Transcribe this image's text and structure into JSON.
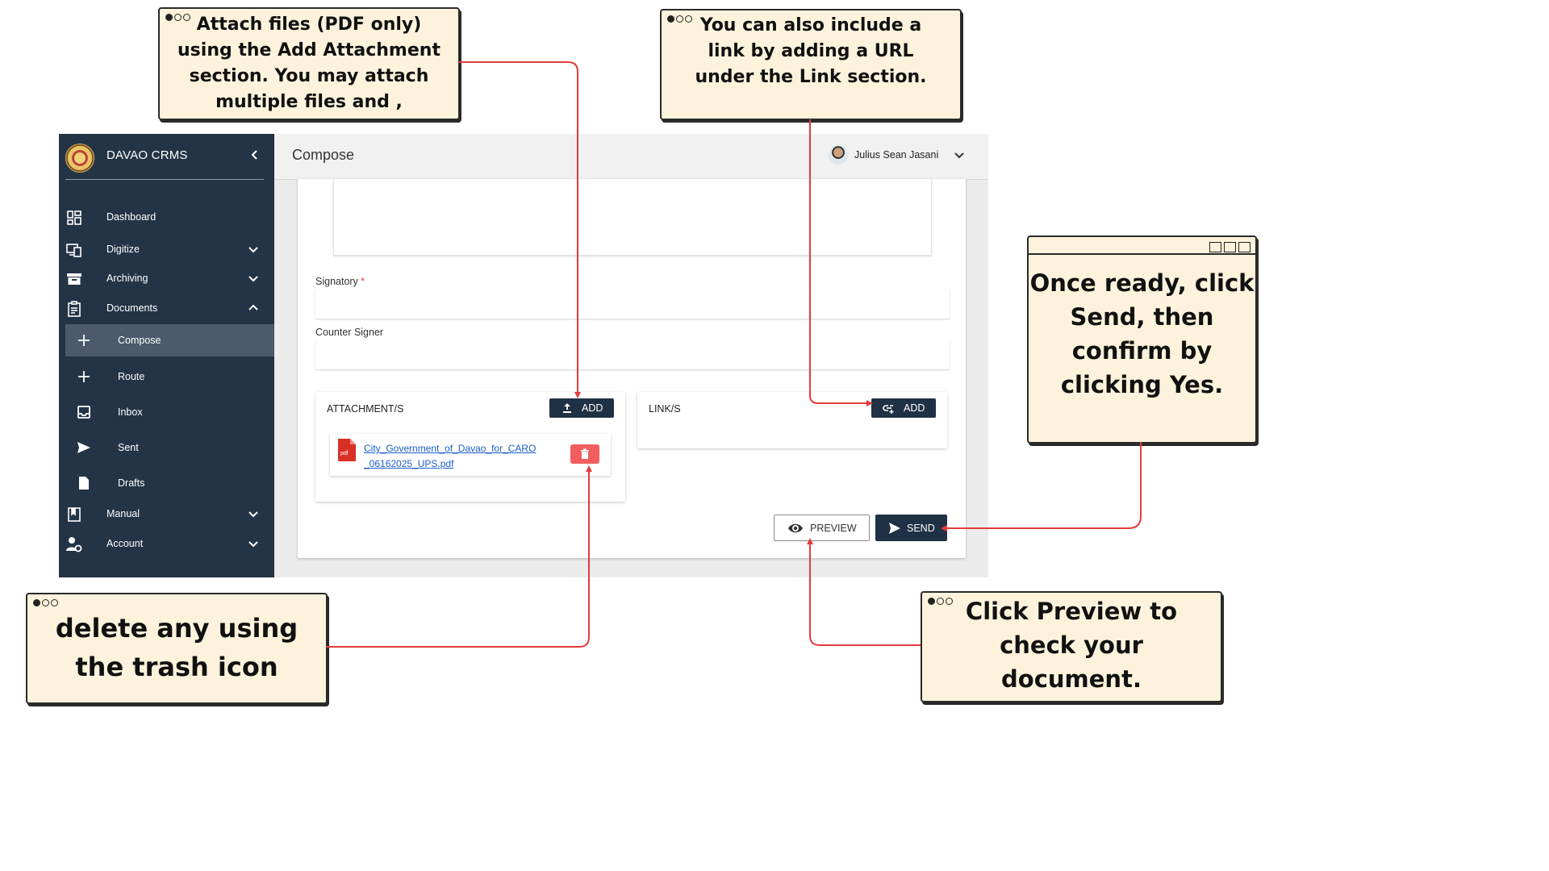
{
  "app": {
    "brand": "DAVAO CRMS",
    "page_title": "Compose",
    "user_name": "Julius Sean Jasani"
  },
  "sidebar": {
    "items": [
      {
        "label": "Dashboard",
        "icon": "dashboard-icon"
      },
      {
        "label": "Digitize",
        "icon": "digitize-icon"
      },
      {
        "label": "Archiving",
        "icon": "archive-icon"
      },
      {
        "label": "Documents",
        "icon": "documents-icon"
      },
      {
        "label": "Manual",
        "icon": "manual-icon"
      },
      {
        "label": "Account",
        "icon": "account-settings-icon"
      }
    ],
    "documents_sub": [
      {
        "label": "Compose",
        "icon": "plus-icon",
        "active": true
      },
      {
        "label": "Route",
        "icon": "plus-icon"
      },
      {
        "label": "Inbox",
        "icon": "inbox-icon"
      },
      {
        "label": "Sent",
        "icon": "send-icon"
      },
      {
        "label": "Drafts",
        "icon": "draft-icon"
      }
    ]
  },
  "form": {
    "signatory_label": "Signatory",
    "required_mark": "*",
    "counter_signer_label": "Counter Signer",
    "attachments_title": "ATTACHMENT/S",
    "links_title": "LINK/S",
    "add_label": "ADD",
    "file_name_line1": "City_Government_of_Davao_for_CARO",
    "file_name_line2": "_06162025_UPS.pdf",
    "pdf_badge": "pdf",
    "preview_label": "PREVIEW",
    "send_label": "SEND"
  },
  "callouts": {
    "attach": [
      "Attach files (PDF only)",
      "using the Add Attachment",
      "section. You may attach",
      "multiple files and ,"
    ],
    "link": [
      "You can also include a",
      "link by adding a URL",
      "under the Link section."
    ],
    "send": [
      "Once ready, click",
      "Send, then",
      "confirm by",
      "clicking Yes."
    ],
    "delete": [
      "delete any using",
      "the trash icon"
    ],
    "preview": [
      "Click Preview to",
      "check your",
      "document."
    ]
  },
  "colors": {
    "sidebar": "#243447",
    "active_item": "#4b5b6d",
    "primary_button": "#1f3144",
    "delete_button": "#f25d5d",
    "arrow": "#e23c3c",
    "callout_bg": "#fdf3dc"
  }
}
